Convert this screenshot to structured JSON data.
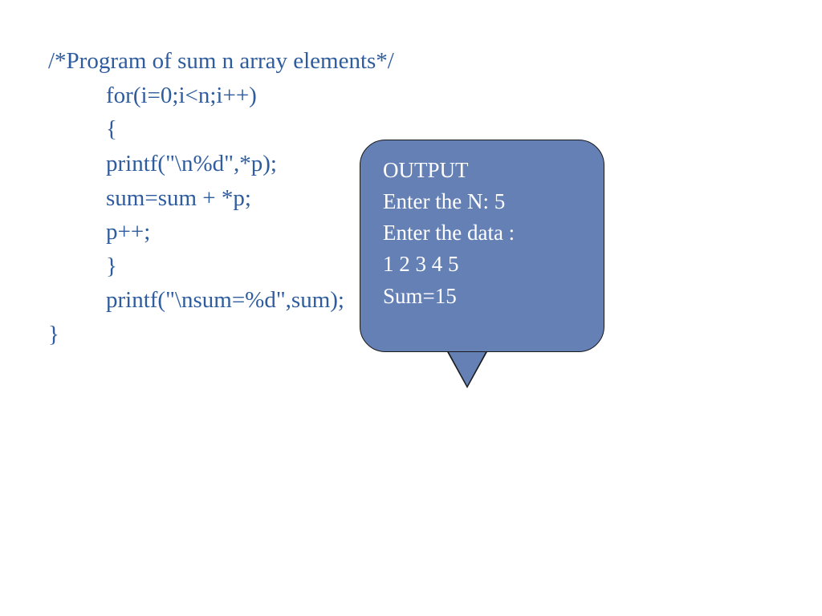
{
  "code": {
    "line1": "/*Program of sum n array elements*/",
    "line2": "for(i=0;i<n;i++)",
    "line3": "{",
    "line4": "printf(\"\\n%d\",*p);",
    "line5": "sum=sum + *p;",
    "line6": "p++;",
    "line7": "}",
    "line8": "printf(\"\\nsum=%d\",sum);",
    "line9": "}"
  },
  "callout": {
    "title": "OUTPUT",
    "line1": "Enter the N: 5",
    "line2": "Enter the data :",
    "line3": "1 2 3 4 5",
    "line4": "Sum=15"
  }
}
